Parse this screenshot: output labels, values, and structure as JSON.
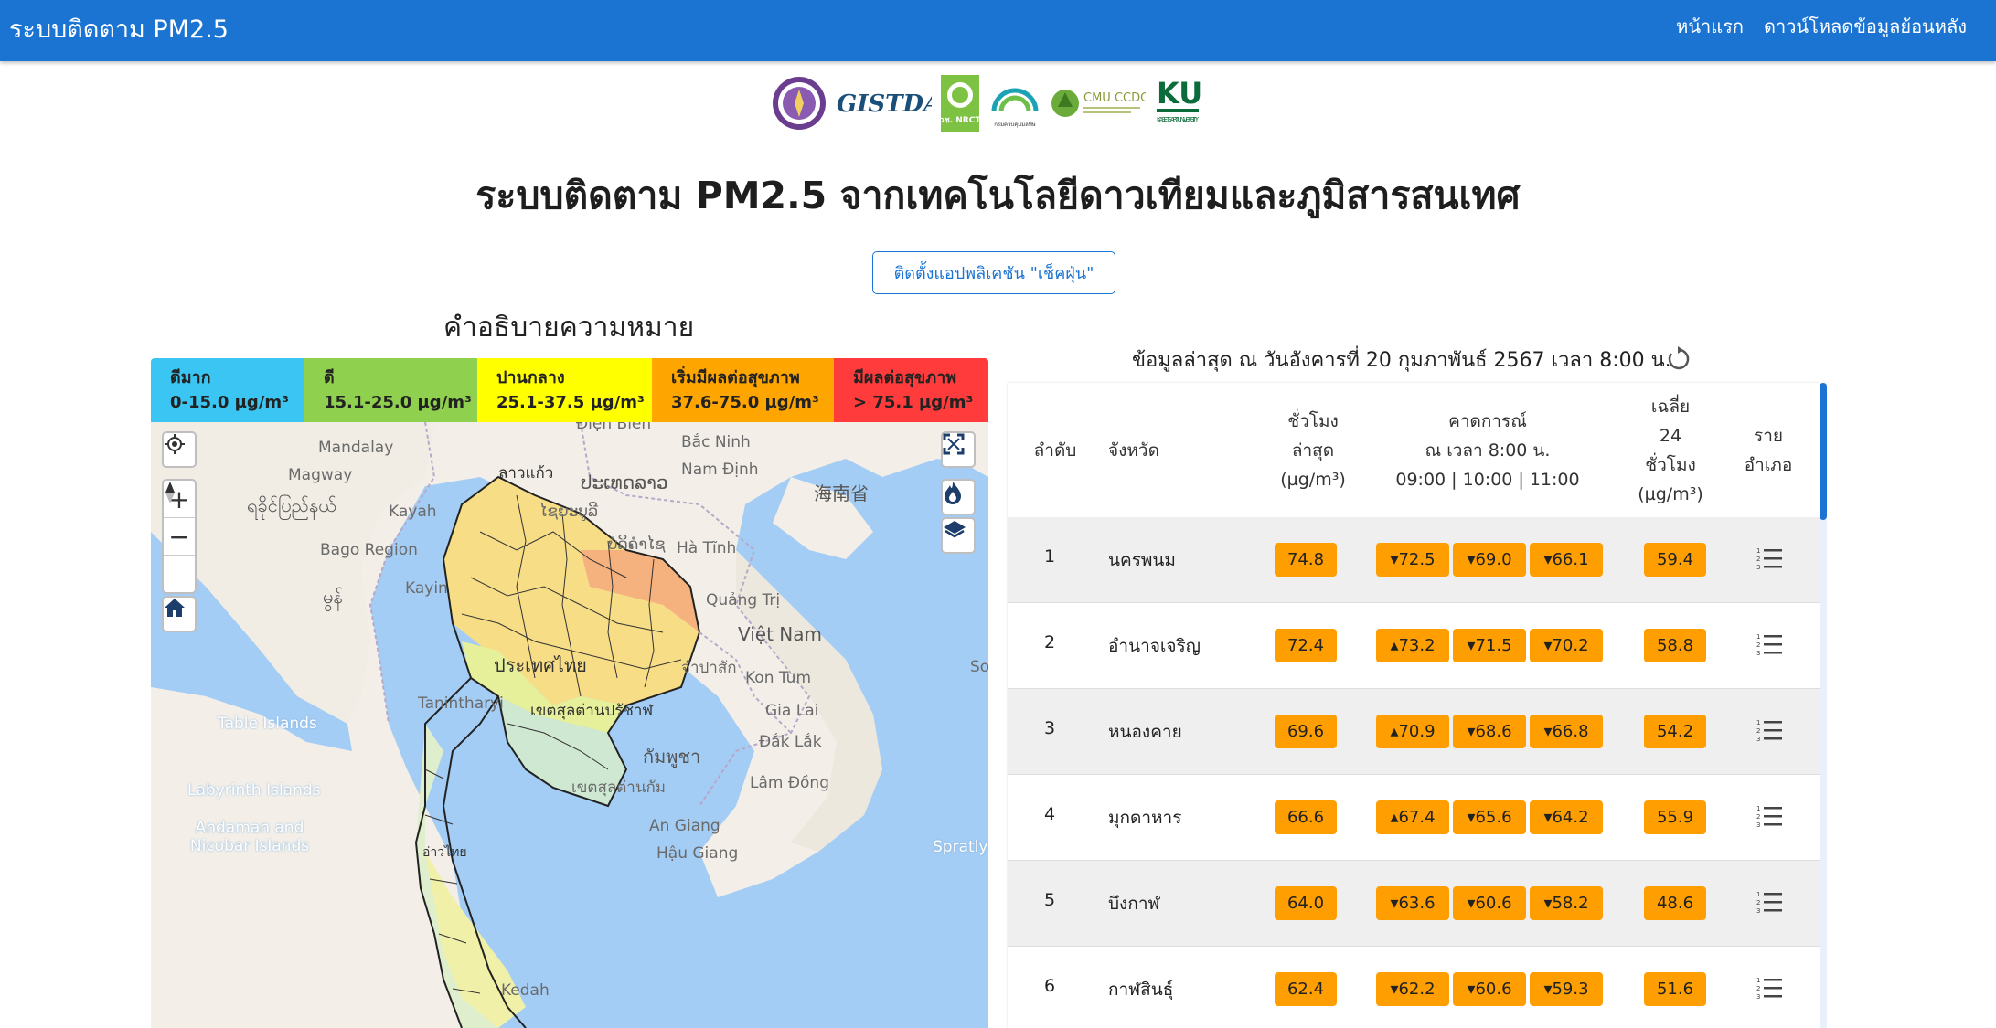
{
  "nav": {
    "brand": "ระบบติดตาม PM2.5",
    "links": [
      "หน้าแรก",
      "ดาวน์โหลดข้อมูลย้อนหลัง"
    ]
  },
  "logos": [
    "GISTDA",
    "วช. NRCT",
    "กรมควบคุมมลพิษ",
    "CMU CCDC",
    "KU",
    "KASETSART UNIVERSITY"
  ],
  "page_title": "ระบบติดตาม PM2.5 จากเทคโนโลยีดาวเทียมและภูมิสารสนเทศ",
  "install_button": "ติดตั้งแอปพลิเคชัน \"เช็คฝุ่น\"",
  "legend": {
    "title": "คำอธิบายความหมาย",
    "items": [
      {
        "label": "ดีมาก",
        "range": "0-15.0 µg/m³",
        "color": "#3ac5f3"
      },
      {
        "label": "ดี",
        "range": "15.1-25.0 µg/m³",
        "color": "#8fd14f"
      },
      {
        "label": "ปานกลาง",
        "range": "25.1-37.5 µg/m³",
        "color": "#ffff00"
      },
      {
        "label": "เริ่มมีผลต่อสุขภาพ",
        "range": "37.6-75.0 µg/m³",
        "color": "#ffa500"
      },
      {
        "label": "มีผลต่อสุขภาพ",
        "range": "> 75.1 µg/m³",
        "color": "#ff3b3b"
      }
    ]
  },
  "map": {
    "labels": [
      "Mandalay",
      "Magway",
      "ရခိုင်ပြည်နယ်",
      "Bago Region",
      "Kayah",
      "Kayin",
      "မွန်",
      "Table Islands",
      "Labyrinth Islands",
      "Andaman and Nicobar Islands",
      "Tanintharyi",
      "Điện Biên",
      "Bắc Ninh",
      "Nam Định",
      "ປະເທດລາວ",
      "ໄຊຍະບູລີ",
      "ບໍລິຄໍາໄຊ",
      "Hà Tĩnh",
      "Quảng Trị",
      "Việt Nam",
      "จำปาสัก",
      "Kon Tum",
      "Gia Lai",
      "Đắk Lắk",
      "Lâm Đồng",
      "กัมพูชา",
      "ประเทศไทย",
      "เขตสุลต่านปรัชาฬ",
      "เขตสุลต่านกัม",
      "An Giang",
      "Hậu Giang",
      "海南省",
      "Spratly I",
      "Kedah",
      "ลาวแก้ว",
      "อ่าวไทย",
      "So"
    ]
  },
  "table": {
    "latest_text": "ข้อมูลล่าสุด ณ วันอังคารที่ 20 กุมภาพันธ์ 2567 เวลา 8:00 น.",
    "headers": {
      "rank": "ลำดับ",
      "province": "จังหวัด",
      "hourly": [
        "ชั่วโมง",
        "ล่าสุด",
        "(µg/m³)"
      ],
      "forecast": [
        "คาดการณ์",
        "ณ เวลา 8:00 น.",
        "09:00 | 10:00 | 11:00"
      ],
      "avg": [
        "เฉลี่ย",
        "24",
        "ชั่วโมง",
        "(µg/m³)"
      ],
      "district": [
        "ราย",
        "อำเภอ"
      ]
    },
    "badge_color": "#ff9e00",
    "rows": [
      {
        "rank": "1",
        "province": "นครพนม",
        "latest": "74.8",
        "f1": "▾72.5",
        "f2": "▾69.0",
        "f3": "▾66.1",
        "avg": "59.4"
      },
      {
        "rank": "2",
        "province": "อำนาจเจริญ",
        "latest": "72.4",
        "f1": "▴73.2",
        "f2": "▾71.5",
        "f3": "▾70.2",
        "avg": "58.8"
      },
      {
        "rank": "3",
        "province": "หนองคาย",
        "latest": "69.6",
        "f1": "▴70.9",
        "f2": "▾68.6",
        "f3": "▾66.8",
        "avg": "54.2"
      },
      {
        "rank": "4",
        "province": "มุกดาหาร",
        "latest": "66.6",
        "f1": "▴67.4",
        "f2": "▾65.6",
        "f3": "▾64.2",
        "avg": "55.9"
      },
      {
        "rank": "5",
        "province": "บึงกาฬ",
        "latest": "64.0",
        "f1": "▾63.6",
        "f2": "▾60.6",
        "f3": "▾58.2",
        "avg": "48.6"
      },
      {
        "rank": "6",
        "province": "กาฬสินธุ์",
        "latest": "62.4",
        "f1": "▾62.2",
        "f2": "▾60.6",
        "f3": "▾59.3",
        "avg": "51.6"
      }
    ]
  }
}
